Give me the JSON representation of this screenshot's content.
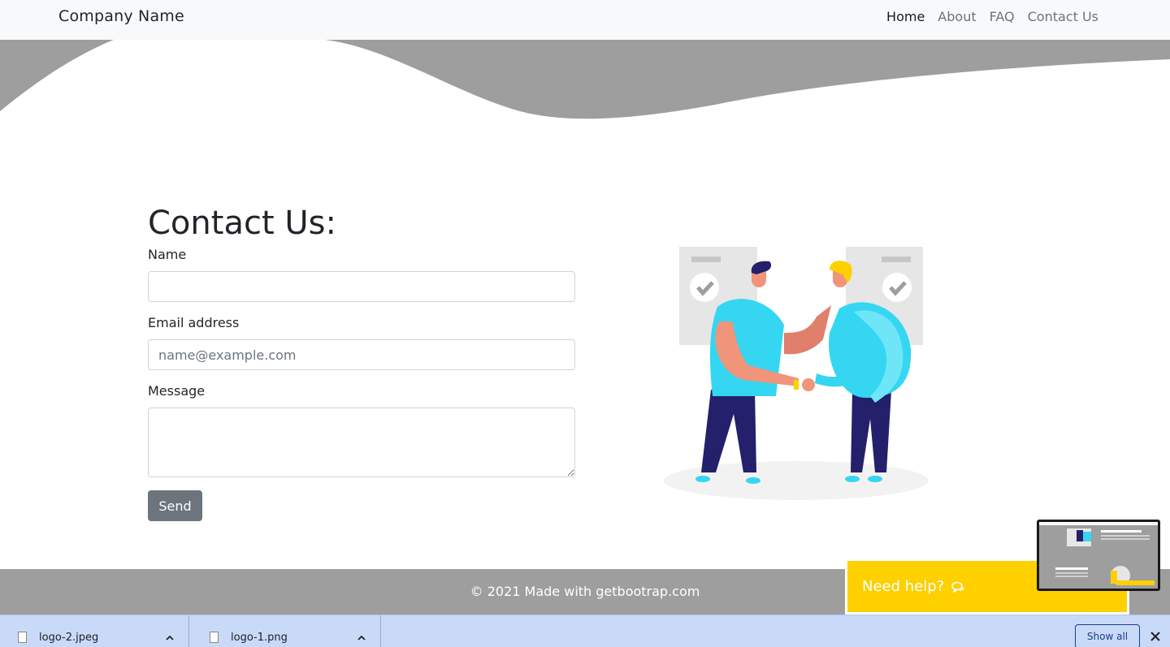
{
  "navbar": {
    "brand": "Company Name",
    "links": [
      {
        "label": "Home"
      },
      {
        "label": "About"
      },
      {
        "label": "FAQ"
      },
      {
        "label": "Contact Us"
      }
    ]
  },
  "form": {
    "title": "Contact Us:",
    "name_label": "Name",
    "name_value": "",
    "email_label": "Email address",
    "email_placeholder": "name@example.com",
    "message_label": "Message",
    "message_value": "",
    "send_label": "Send"
  },
  "footer": {
    "text": "© 2021 Made with getbootrap.com"
  },
  "help_widget": {
    "label": "Need help?",
    "icon": "chat-icon"
  },
  "download_bar": {
    "items": [
      {
        "name": "logo-2.jpeg"
      },
      {
        "name": "logo-1.png"
      }
    ],
    "show_all_label": "Show all"
  },
  "colors": {
    "wave": "#9e9e9e",
    "help_yellow": "#fed000",
    "send_button": "#6c757d",
    "figure_shirt": "#35d6f2",
    "figure_pants": "#24206b"
  }
}
